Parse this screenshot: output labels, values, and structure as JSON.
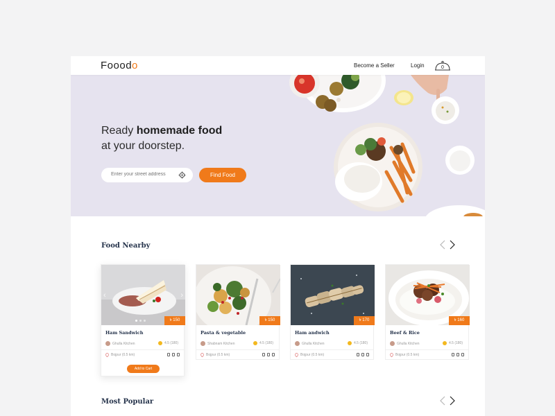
{
  "nav": {
    "logo": "Fooodo",
    "become_seller": "Become a Seller",
    "login": "Login",
    "cart_count": "0"
  },
  "hero": {
    "title_plain": "Ready ",
    "title_bold": "homemade food",
    "title_line2": "at your doorstep.",
    "address_placeholder": "Enter your street address",
    "find_button": "Find Food"
  },
  "sections": {
    "nearby_title": "Food Nearby",
    "popular_title": "Most Popular"
  },
  "cards": [
    {
      "name": "Ham Sandwich",
      "price": "৳ 150",
      "chef": "Ghulla Kitchen",
      "rating": "4.5 (180)",
      "location": "Bojpur (0.5 km)",
      "add_to_cart": "Add to Cart"
    },
    {
      "name": "Pasta & vegetable",
      "price": "৳ 150",
      "chef": "Shabnam Kitchen",
      "rating": "4.5 (180)",
      "location": "Bojpur (0.5 km)"
    },
    {
      "name": "Ham andwich",
      "price": "৳ 170",
      "chef": "Ghulla Kitchen",
      "rating": "4.5 (180)",
      "location": "Bojpur (0.5 km)"
    },
    {
      "name": "Beef & Rice",
      "price": "৳ 160",
      "chef": "Ghulla Kitchen",
      "rating": "4.5 (180)",
      "location": "Bojpur (0.5 km)"
    }
  ],
  "colors": {
    "accent": "#f07a1a",
    "hero_bg": "#e6e3ef",
    "heading": "#24324a"
  }
}
